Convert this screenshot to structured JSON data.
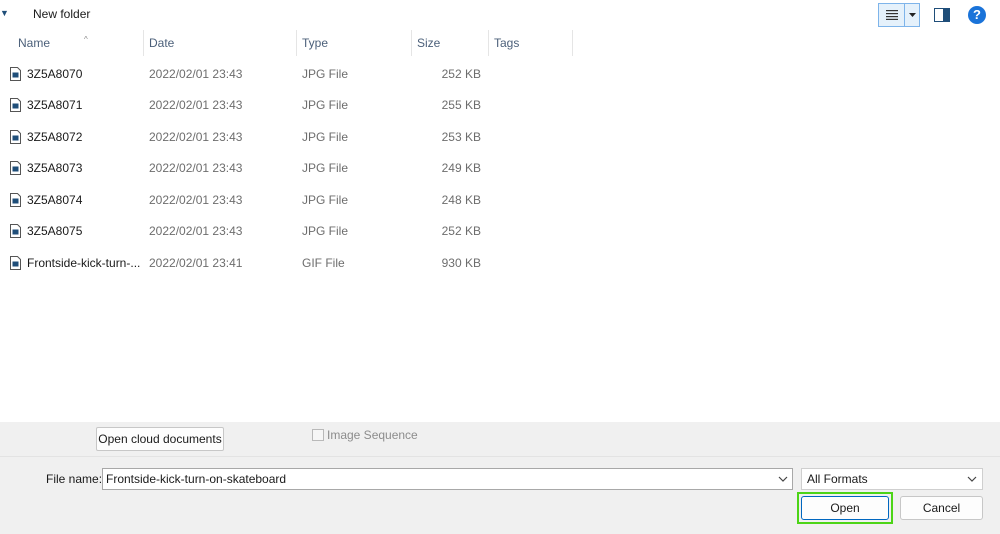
{
  "toolbar": {
    "new_folder_label": "New folder",
    "help_glyph": "?"
  },
  "columns": {
    "name": "Name",
    "date": "Date",
    "type": "Type",
    "size": "Size",
    "tags": "Tags"
  },
  "files": [
    {
      "name": "3Z5A8070",
      "date": "2022/02/01 23:43",
      "type": "JPG File",
      "size": "252 KB"
    },
    {
      "name": "3Z5A8071",
      "date": "2022/02/01 23:43",
      "type": "JPG File",
      "size": "255 KB"
    },
    {
      "name": "3Z5A8072",
      "date": "2022/02/01 23:43",
      "type": "JPG File",
      "size": "253 KB"
    },
    {
      "name": "3Z5A8073",
      "date": "2022/02/01 23:43",
      "type": "JPG File",
      "size": "249 KB"
    },
    {
      "name": "3Z5A8074",
      "date": "2022/02/01 23:43",
      "type": "JPG File",
      "size": "248 KB"
    },
    {
      "name": "3Z5A8075",
      "date": "2022/02/01 23:43",
      "type": "JPG File",
      "size": "252 KB"
    },
    {
      "name": "Frontside-kick-turn-...",
      "date": "2022/02/01 23:41",
      "type": "GIF File",
      "size": "930 KB"
    }
  ],
  "options": {
    "open_cloud_label": "Open cloud documents",
    "image_sequence_label": "Image Sequence"
  },
  "filename": {
    "label": "File name:",
    "value": "Frontside-kick-turn-on-skateboard"
  },
  "format": {
    "selected": "All Formats"
  },
  "buttons": {
    "open_label": "Open",
    "cancel_label": "Cancel"
  },
  "colors": {
    "highlight_outline": "#4cd416",
    "accent": "#0067c0"
  }
}
